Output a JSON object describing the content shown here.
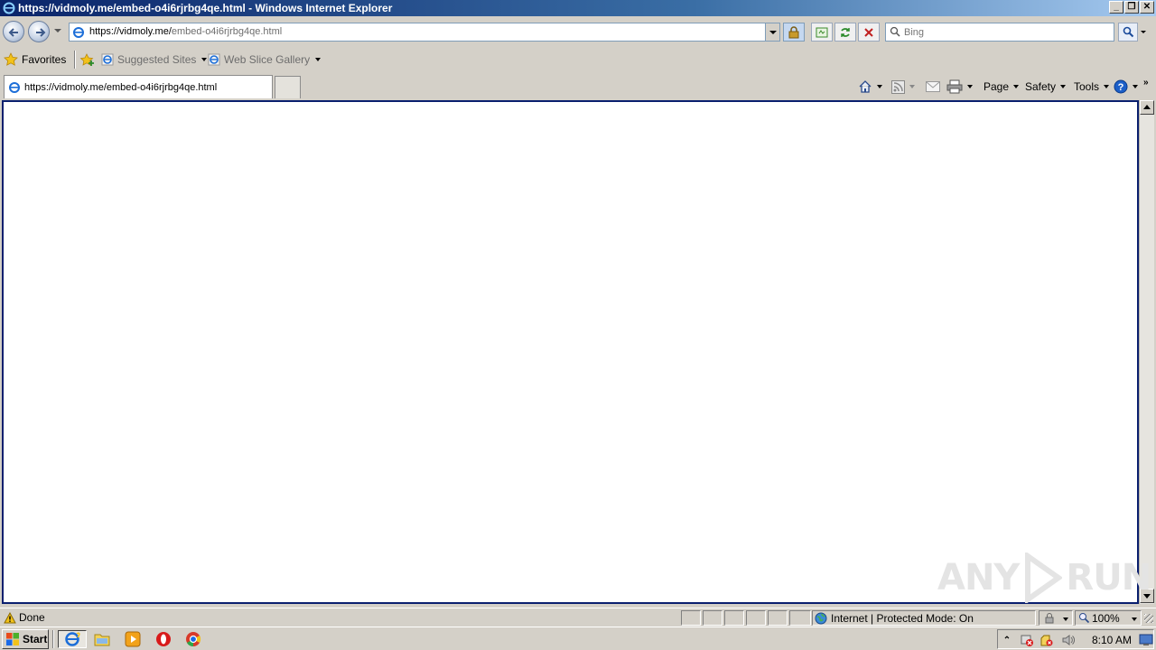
{
  "window": {
    "title": "https://vidmoly.me/embed-o4i6rjrbg4qe.html - Windows Internet Explorer"
  },
  "address": {
    "url_host": "https://vidmoly.me/",
    "url_path": "embed-o4i6rjrbg4qe.html",
    "search_placeholder": "Bing"
  },
  "favorites": {
    "favorites_label": "Favorites",
    "links": [
      "Suggested Sites",
      "Web Slice Gallery"
    ]
  },
  "tabs": {
    "active_label": "https://vidmoly.me/embed-o4i6rjrbg4qe.html"
  },
  "commands": {
    "page": "Page",
    "safety": "Safety",
    "tools": "Tools"
  },
  "watermark": {
    "left": "ANY",
    "right": "RUN"
  },
  "statusbar": {
    "status": "Done",
    "zone": "Internet | Protected Mode: On",
    "zoom": "100%"
  },
  "taskbar": {
    "start_label": "Start",
    "time": "8:10 AM"
  }
}
